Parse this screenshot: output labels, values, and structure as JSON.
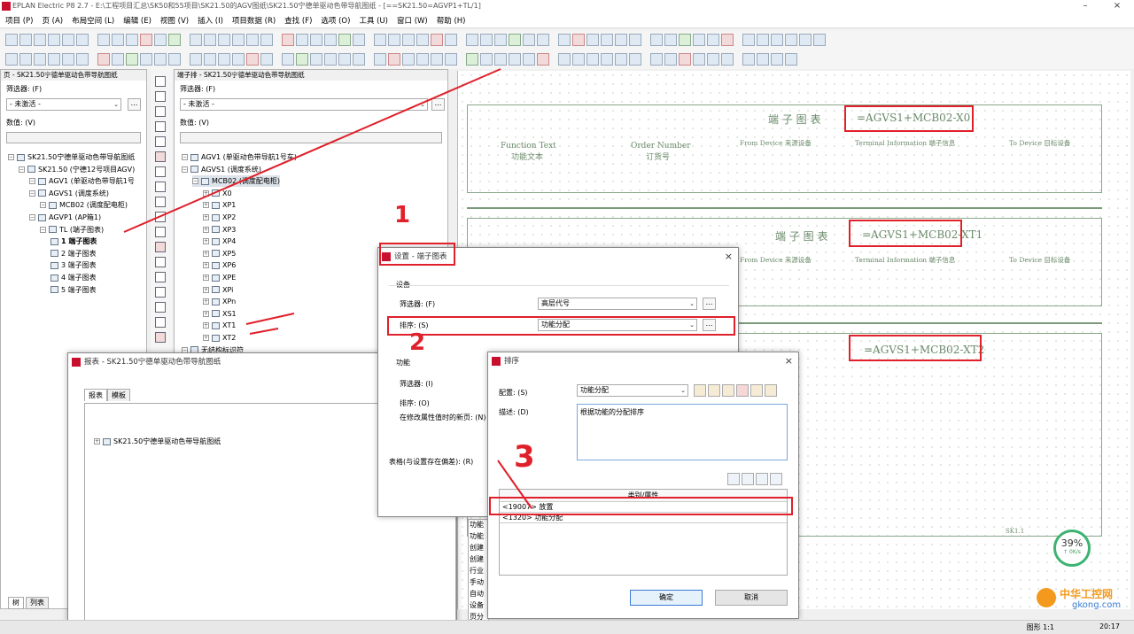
{
  "window": {
    "title": "EPLAN Electric P8 2.7 - E:\\工程项目汇总\\SK50和55项目\\SK21.50的AGV图纸\\SK21.50宁德单驱动色带导航图纸 - [==SK21.50=AGVP1+TL/1]",
    "minimize": "–",
    "close": "×"
  },
  "menu": [
    "项目 (P)",
    "页 (A)",
    "布局空间 (L)",
    "编辑 (E)",
    "视图 (V)",
    "插入 (I)",
    "项目数据 (R)",
    "查找 (F)",
    "选项 (O)",
    "工具 (U)",
    "窗口 (W)",
    "帮助 (H)"
  ],
  "page_nav": {
    "header": "页 - SK21.50宁德单驱动色带导航图纸",
    "filter_label": "筛选器: (F)",
    "filter_value": "- 未激活 -",
    "value_label": "数值: (V)",
    "tree": [
      {
        "label": "SK21.50宁德单驱动色带导航图纸"
      },
      {
        "label": "SK21.50 (宁德12号项目AGV)"
      },
      {
        "label": "AGV1 (单驱动色带导航1号"
      },
      {
        "label": "AGVS1 (调度系统)"
      },
      {
        "label": "MCB02 (调度配电柜)"
      },
      {
        "label": "AGVP1 (AP箱1)"
      },
      {
        "label": "TL (端子图表)"
      },
      {
        "label": "1 端子图表"
      },
      {
        "label": "2 端子图表"
      },
      {
        "label": "3 端子图表"
      },
      {
        "label": "4 端子图表"
      },
      {
        "label": "5 端子图表"
      }
    ],
    "tab_tree": "树",
    "tab_list": "列表"
  },
  "terminal_nav": {
    "header": "端子排 - SK21.50宁德单驱动色带导航图纸",
    "filter_label": "筛选器: (F)",
    "filter_value": "- 未激活 -",
    "value_label": "数值: (V)",
    "tree": [
      {
        "label": "AGV1 (单驱动色带导航1号车)"
      },
      {
        "label": "AGVS1 (调度系统)"
      },
      {
        "label": "MCB02 (调度配电柜)"
      },
      {
        "label": "X0"
      },
      {
        "label": "XP1"
      },
      {
        "label": "XP2"
      },
      {
        "label": "XP3"
      },
      {
        "label": "XP4"
      },
      {
        "label": "XP5"
      },
      {
        "label": "XP6"
      },
      {
        "label": "XPE"
      },
      {
        "label": "XPi"
      },
      {
        "label": "XPn"
      },
      {
        "label": "XS1"
      },
      {
        "label": "XT1"
      },
      {
        "label": "XT2"
      },
      {
        "label": "无结构标识符"
      }
    ]
  },
  "cad": {
    "blocks": [
      {
        "title": "端 子 图 表",
        "id": "=AGVS1+MCB02-X0"
      },
      {
        "title": "端 子 图 表",
        "id": "=AGVS1+MCB02-XT1"
      },
      {
        "title": "",
        "id": "=AGVS1+MCB02-XT2"
      }
    ],
    "col_function": "Function Text",
    "col_function_cn": "功能文本",
    "col_order": "Order Number",
    "col_order_cn": "订货号",
    "col_from": "From Device 来源设备",
    "col_info": "Terminal Information 端子信息",
    "col_to": "To Device 目标设备",
    "sheet_ref": "SK1.1",
    "progress": "39%",
    "progress_sub": "↑ 0K/s"
  },
  "report_dialog": {
    "title": "报表 - SK21.50宁德单驱动色带导航图纸",
    "tab_reports": "报表",
    "tab_templates": "模板",
    "tree_root": "SK21.50宁德单驱动色带导航图纸",
    "prop_rows": [
      "功能",
      "功能",
      "创建",
      "创建",
      "行业",
      "手动",
      "自动",
      "设备",
      "页分"
    ]
  },
  "settings_dialog": {
    "title": "设置 - 端子图表",
    "section_device": "设备",
    "filter_label": "筛选器: (F)",
    "filter_value": "高层代号",
    "sort_label": "排序: (S)",
    "sort_value": "功能分配",
    "section_function": "功能",
    "filter2_label": "筛选器: (I)",
    "sort2_label": "排序: (O)",
    "newpage_label": "在修改属性值时的新页: (N)",
    "table_label": "表格(与设置存在偏差): (R)"
  },
  "sort_dialog": {
    "title": "排序",
    "config_label": "配置: (S)",
    "config_value": "功能分配",
    "desc_label": "描述: (D)",
    "desc_value": "根据功能的分配排序",
    "table_header": "类别/属性",
    "rows": [
      "<19007> 放置",
      "<1320> 功能分配"
    ],
    "ok": "确定",
    "cancel": "取消"
  },
  "annotations": {
    "n1": "1",
    "n2": "2",
    "n3": "3"
  },
  "statusbar": {
    "right": "图形 1:1",
    "time": "20:17"
  },
  "watermark": {
    "cn": "中华工控网",
    "en": "gkong.com"
  },
  "colors": {
    "annotation_red": "#e0202a",
    "eplan_red": "#c8102e",
    "cad_green": "#6a8a6a"
  }
}
